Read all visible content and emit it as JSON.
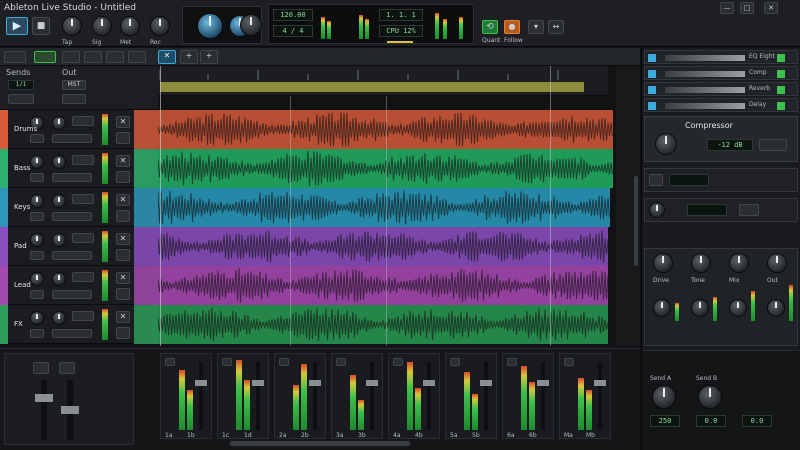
{
  "title": "Ableton Live Studio - Untitled",
  "transport": {
    "play": "▶",
    "stop": "■",
    "record": "●",
    "loop": "⟲",
    "tempo": "120.00",
    "signature": "4 / 4",
    "position": "1. 1. 1",
    "cpu": "CPU 12%",
    "labels": [
      "Tap",
      "Sig",
      "Met",
      "Rec",
      "Quant",
      "Follow"
    ]
  },
  "topright_buttons": [
    "—",
    "□",
    "✕"
  ],
  "left_panel": {
    "labels": [
      "Sends",
      "Out"
    ],
    "value": "1/1",
    "sub": "MST"
  },
  "tracks": [
    {
      "name": "Drums",
      "color": "#d65b3b",
      "lane": "#b84e33"
    },
    {
      "name": "Bass",
      "color": "#2fb070",
      "lane": "#1f9a59"
    },
    {
      "name": "Keys",
      "color": "#2f96b8",
      "lane": "#2488a6"
    },
    {
      "name": "Pad",
      "color": "#8a4fbf",
      "lane": "#7a46a9"
    },
    {
      "name": "Lead",
      "color": "#a24ab0",
      "lane": "#93419d"
    },
    {
      "name": "FX",
      "color": "#2f9c5c",
      "lane": "#258649"
    }
  ],
  "mixer": {
    "labels": [
      "1a",
      "1b",
      "1c",
      "1d",
      "2a",
      "2b",
      "3a",
      "3b",
      "4a",
      "4b",
      "5a",
      "5b",
      "6a",
      "6b",
      "Ma",
      "Mb"
    ]
  },
  "right_panel": {
    "rows": [
      "EQ Eight",
      "Comp",
      "Reverb",
      "Delay"
    ],
    "device_title": "Compressor",
    "device_value": "-12 dB",
    "knob_labels": [
      "Drive",
      "Tone",
      "Mix",
      "Out"
    ],
    "send_labels": [
      "Send A",
      "Send B"
    ],
    "send_values": [
      "250",
      "0.0",
      "0.0"
    ]
  },
  "colors": {
    "accent": "#3da9d6",
    "ruler": "#8b8d3a",
    "green": "#3cc04b"
  }
}
